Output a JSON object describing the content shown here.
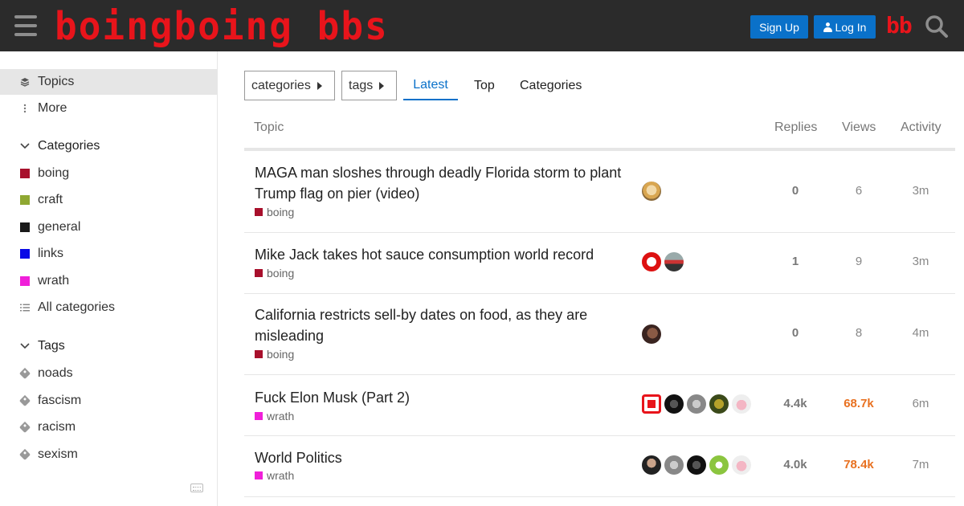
{
  "header": {
    "logo_text": "boingboing bbs",
    "signup_label": "Sign Up",
    "login_label": "Log In",
    "bb_icon_text": "bb"
  },
  "sidebar": {
    "top_items": [
      {
        "label": "Topics",
        "icon": "layers-icon"
      },
      {
        "label": "More",
        "icon": "ellipsis-vertical-icon"
      }
    ],
    "categories_header": "Categories",
    "categories": [
      {
        "label": "boing",
        "color": "#a8102c"
      },
      {
        "label": "craft",
        "color": "#8fa832"
      },
      {
        "label": "general",
        "color": "#1a1a1a"
      },
      {
        "label": "links",
        "color": "#0a0ae6"
      },
      {
        "label": "wrath",
        "color": "#f01fd9"
      }
    ],
    "all_categories_label": "All categories",
    "tags_header": "Tags",
    "tags": [
      {
        "label": "noads"
      },
      {
        "label": "fascism"
      },
      {
        "label": "racism"
      },
      {
        "label": "sexism"
      }
    ]
  },
  "nav": {
    "categories_dropdown": "categories",
    "tags_dropdown": "tags",
    "tabs": [
      "Latest",
      "Top",
      "Categories"
    ],
    "active_tab": "Latest"
  },
  "table": {
    "headers": {
      "topic": "Topic",
      "replies": "Replies",
      "views": "Views",
      "activity": "Activity"
    },
    "rows": [
      {
        "title": "MAGA man sloshes through deadly Florida storm to plant Trump flag on pier (video)",
        "category": "boing",
        "category_color": "#a8102c",
        "replies": "0",
        "views": "6",
        "activity": "3m",
        "hot": false
      },
      {
        "title": "Mike Jack takes hot sauce consumption world record",
        "category": "boing",
        "category_color": "#a8102c",
        "replies": "1",
        "views": "9",
        "activity": "3m",
        "hot": false
      },
      {
        "title": "California restricts sell-by dates on food, as they are misleading",
        "category": "boing",
        "category_color": "#a8102c",
        "replies": "0",
        "views": "8",
        "activity": "4m",
        "hot": false
      },
      {
        "title": "Fuck Elon Musk (Part 2)",
        "category": "wrath",
        "category_color": "#f01fd9",
        "replies": "4.4k",
        "views": "68.7k",
        "activity": "6m",
        "hot": true
      },
      {
        "title": "World Politics",
        "category": "wrath",
        "category_color": "#f01fd9",
        "replies": "4.0k",
        "views": "78.4k",
        "activity": "7m",
        "hot": true
      }
    ]
  }
}
